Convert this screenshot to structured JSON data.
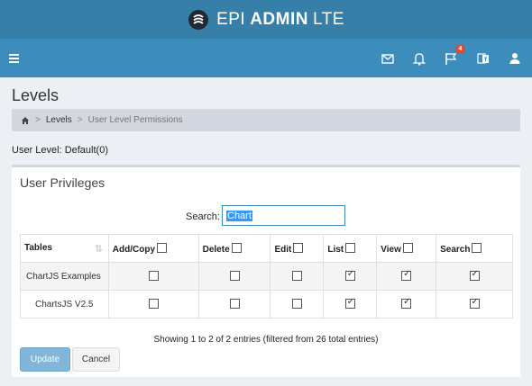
{
  "brand": {
    "part1": "EPI",
    "part2": "ADMIN",
    "part3": "LTE"
  },
  "navbar": {
    "notification_count": "4"
  },
  "page": {
    "title": "Levels"
  },
  "breadcrumb": {
    "link": "Levels",
    "active": "User Level Permissions"
  },
  "level_text": "User Level: Default(0)",
  "box": {
    "title": "User Privileges"
  },
  "search": {
    "label": "Search:",
    "value": "Chart"
  },
  "table": {
    "headers": [
      "Tables",
      "Add/Copy",
      "Delete",
      "Edit",
      "List",
      "View",
      "Search"
    ],
    "rows": [
      {
        "name": "ChartJS Examples",
        "add": false,
        "delete": false,
        "edit": false,
        "list": true,
        "view": true,
        "search": true
      },
      {
        "name": "ChartsJS V2.5",
        "add": false,
        "delete": false,
        "edit": false,
        "list": true,
        "view": true,
        "search": true
      }
    ]
  },
  "info": "Showing 1 to 2 of 2 entries (filtered from 26 total entries)",
  "buttons": {
    "update": "Update",
    "cancel": "Cancel"
  },
  "colors": {
    "navbar": "#3c8dbc",
    "logo_bar": "#367fa9",
    "badge": "#dd4b39",
    "update_button": "#82b5d7"
  }
}
